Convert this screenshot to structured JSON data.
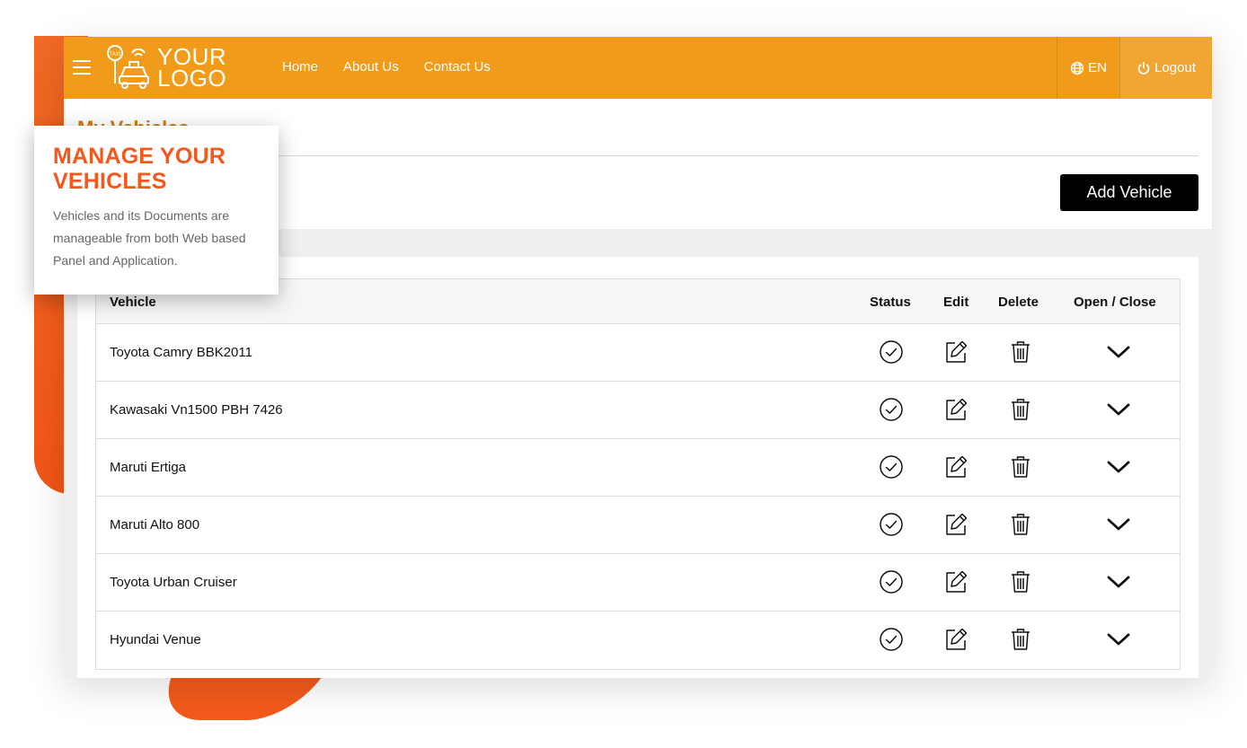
{
  "navbar": {
    "logo": {
      "line1": "YOUR",
      "line2": "LOGO",
      "badge": "TAXI"
    },
    "links": [
      "Home",
      "About Us",
      "Contact Us"
    ],
    "language": "EN",
    "logout": "Logout"
  },
  "page": {
    "title": "My Vehicles",
    "add_button": "Add Vehicle"
  },
  "table": {
    "columns": {
      "vehicle": "Vehicle",
      "status": "Status",
      "edit": "Edit",
      "delete": "Delete",
      "toggle": "Open / Close"
    },
    "rows": [
      {
        "name": "Toyota Camry BBK2011"
      },
      {
        "name": "Kawasaki Vn1500 PBH 7426"
      },
      {
        "name": "Maruti Ertiga"
      },
      {
        "name": "Maruti Alto 800"
      },
      {
        "name": "Toyota Urban Cruiser"
      },
      {
        "name": "Hyundai Venue"
      }
    ]
  },
  "callout": {
    "title_line1": "MANAGE YOUR",
    "title_line2": "VEHICLES",
    "text": "Vehicles and its Documents are manageable from both Web based Panel and Application."
  },
  "icons": {
    "menu": "hamburger-icon",
    "globe": "globe-icon",
    "power": "power-icon",
    "status": "check-circle-icon",
    "edit": "edit-icon",
    "delete": "trash-icon",
    "toggle": "chevron-down-icon"
  },
  "colors": {
    "navbar": "#f09c1a",
    "accent": "#f4581c",
    "title": "#d17818",
    "button": "#000000"
  }
}
